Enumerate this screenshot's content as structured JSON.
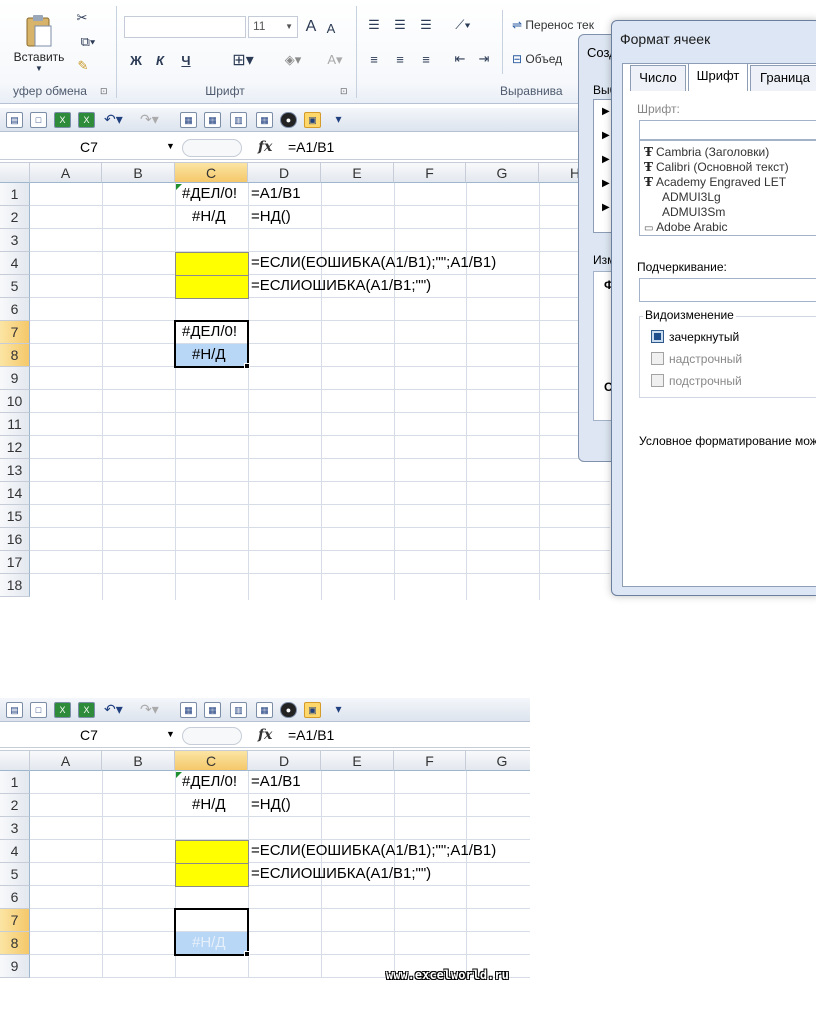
{
  "ribbon": {
    "paste_label": "Вставить",
    "font_size": "11",
    "wrap_text_label": "Перенос тек",
    "merge_label": "Объед",
    "group_clipboard": "уфер обмена",
    "group_font": "Шрифт",
    "group_alignment": "Выравнива",
    "bold": "Ж",
    "italic": "К",
    "underline": "Ч",
    "grow_font": "A",
    "shrink_font": "A"
  },
  "top": {
    "name_box": "C7",
    "fx": "fx",
    "formula": "=A1/B1",
    "columns": [
      "A",
      "B",
      "C",
      "D",
      "E",
      "F",
      "G",
      "H"
    ],
    "rows": [
      "1",
      "2",
      "3",
      "4",
      "5",
      "6",
      "7",
      "8",
      "9",
      "10",
      "11",
      "12",
      "13",
      "14",
      "15",
      "16",
      "17",
      "18"
    ],
    "cells": {
      "c1": "#ДЕЛ/0!",
      "d1": "=A1/B1",
      "c2": "#Н/Д",
      "d2": "=НД()",
      "d4": "=ЕСЛИ(ЕОШИБКА(A1/B1);\"\";A1/B1)",
      "d5": "=ЕСЛИОШИБКА(A1/B1;\"\")",
      "c7": "#ДЕЛ/0!",
      "c8": "#Н/Д"
    }
  },
  "dialog_behind": {
    "title": "Созд",
    "label1": "Выб",
    "label2": "Изм",
    "label3": "Ф",
    "label4": "О"
  },
  "dialog": {
    "title": "Формат ячеек",
    "tabs": [
      "Число",
      "Шрифт",
      "Граница"
    ],
    "font_label": "Шрифт:",
    "fonts": [
      "Cambria (Заголовки)",
      "Calibri (Основной текст)",
      "Academy Engraved LET",
      "ADMUI3Lg",
      "ADMUI3Sm",
      "Adobe Arabic"
    ],
    "underline_label": "Подчеркивание:",
    "effects_label": "Видоизменение",
    "strikethrough": "зачеркнутый",
    "superscript": "надстрочный",
    "subscript": "подстрочный",
    "note": "Условное форматирование мож"
  },
  "bottom": {
    "name_box": "C7",
    "fx": "fx",
    "formula": "=A1/B1",
    "columns": [
      "A",
      "B",
      "C",
      "D",
      "E",
      "F",
      "G"
    ],
    "rows": [
      "1",
      "2",
      "3",
      "4",
      "5",
      "6",
      "7",
      "8",
      "9"
    ],
    "cells": {
      "c1": "#ДЕЛ/0!",
      "d1": "=A1/B1",
      "c2": "#Н/Д",
      "d2": "=НД()",
      "d4": "=ЕСЛИ(ЕОШИБКА(A1/B1);\"\";A1/B1)",
      "d5": "=ЕСЛИОШИБКА(A1/B1;\"\")",
      "c8": "#Н/Д"
    }
  },
  "watermark": "www.excelworld.ru",
  "colors": {
    "highlight_yellow": "#ffff00",
    "selected_blue": "#b8d6f5",
    "header_selected": "#f5c86a"
  }
}
